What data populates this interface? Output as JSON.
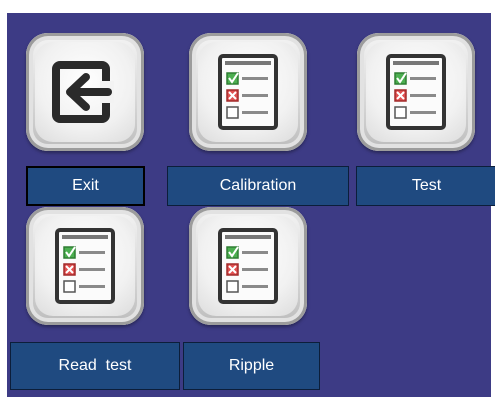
{
  "buttons": [
    {
      "id": "exit",
      "label": "Exit",
      "icon": "exit-arrow-icon",
      "selected": true
    },
    {
      "id": "calibration",
      "label": "Calibration",
      "icon": "checklist-icon"
    },
    {
      "id": "test",
      "label": "Test",
      "icon": "checklist-icon"
    },
    {
      "id": "read_test",
      "label": "Read  test",
      "icon": "checklist-icon"
    },
    {
      "id": "ripple",
      "label": "Ripple",
      "icon": "checklist-icon"
    }
  ],
  "colors": {
    "panel": "#3d3b85",
    "label_bg": "#1f4a80",
    "check_green": "#2e9b2e",
    "cross_red": "#d22b2b"
  }
}
